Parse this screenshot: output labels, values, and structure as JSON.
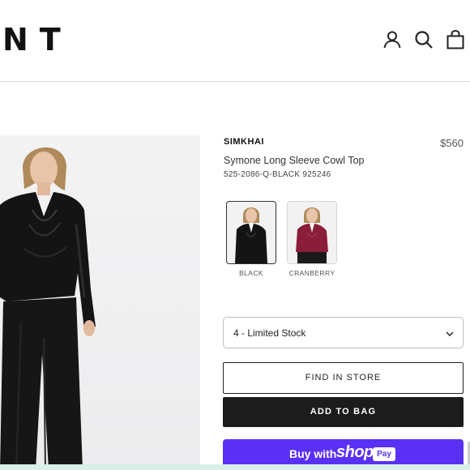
{
  "header": {
    "logo_text": "NT",
    "icons": [
      "account-icon",
      "search-icon",
      "bag-icon"
    ]
  },
  "product": {
    "brand": "SIMKHAI",
    "price": "$560",
    "title": "Symone Long Sleeve Cowl Top",
    "sku": "525-2086-Q-BLACK 925246",
    "swatches": [
      {
        "label": "BLACK",
        "color": "#111111",
        "selected": true
      },
      {
        "label": "CRANBERRY",
        "color": "#8a1d3a",
        "selected": false
      }
    ],
    "quantity_select": {
      "value": "4 -  Limited Stock"
    }
  },
  "actions": {
    "find_in_store": "FIND IN STORE",
    "add_to_bag": "ADD TO BAG",
    "shop_pay": {
      "buy_with": "Buy with",
      "shop": "shop",
      "pay": "Pay"
    }
  },
  "colors": {
    "shop_pay_purple": "#5a31f4",
    "add_to_bag_bg": "#1c1c1c"
  }
}
